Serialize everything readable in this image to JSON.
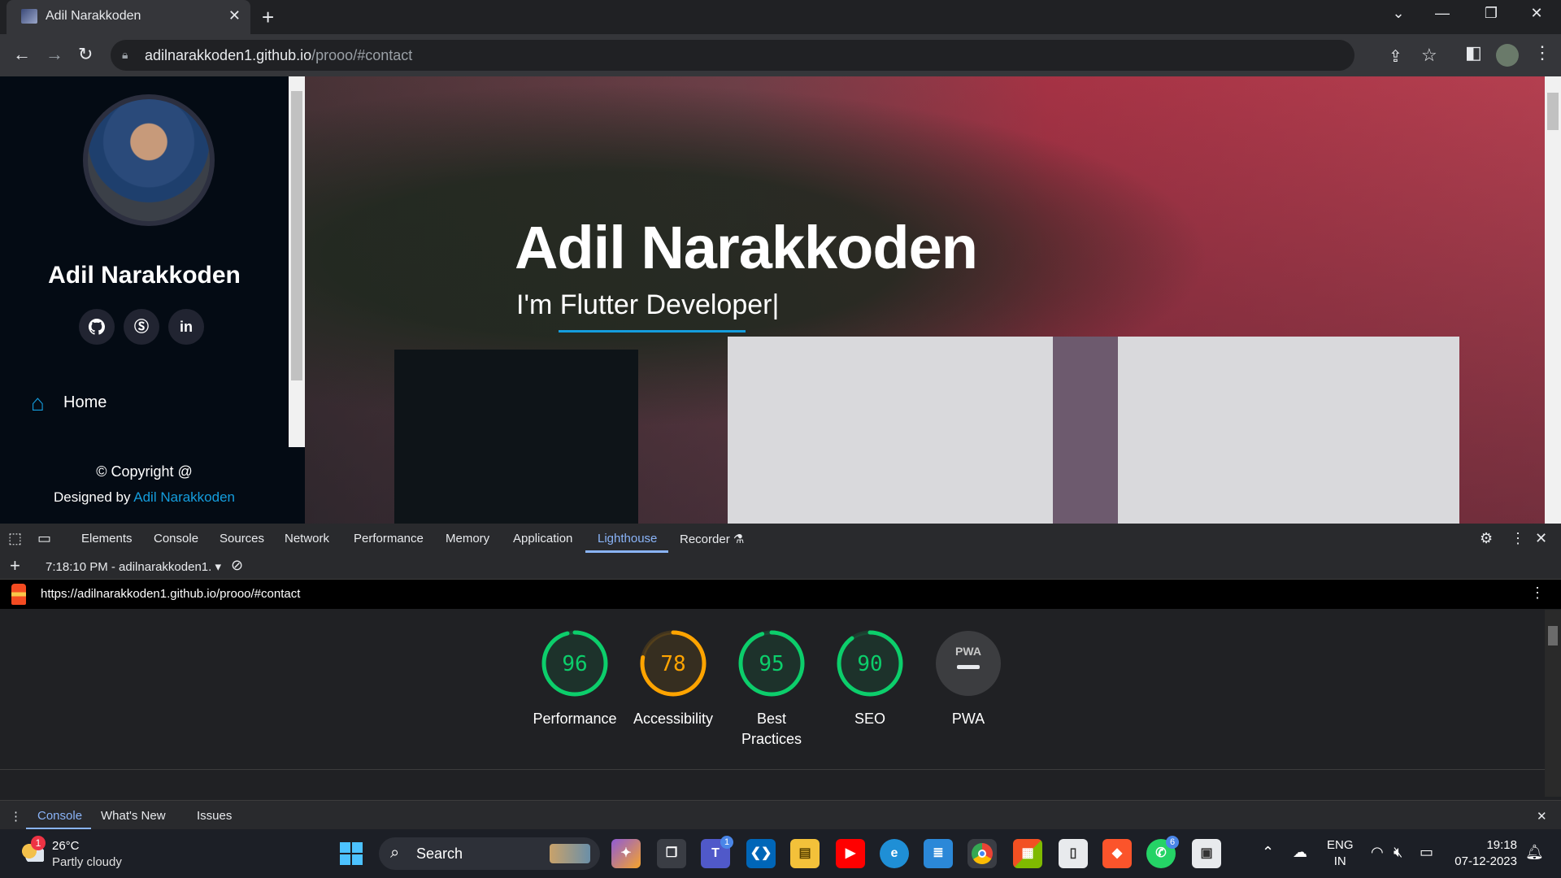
{
  "browser": {
    "tab_title": "Adil Narakkoden",
    "url_host": "adilnarakkoden1.github.io",
    "url_path": "/prooo/#contact"
  },
  "site": {
    "sidebar": {
      "name": "Adil Narakkoden",
      "social": [
        "github",
        "skype",
        "in"
      ],
      "nav_home": "Home",
      "copyright": "© Copyright @",
      "designed_prefix": "Designed by ",
      "designed_link": "Adil Narakkoden"
    },
    "hero": {
      "title": "Adil Narakkoden",
      "subtitle": "I'm Flutter Developer|"
    }
  },
  "devtools": {
    "tabs": [
      "Elements",
      "Console",
      "Sources",
      "Network",
      "Performance",
      "Memory",
      "Application",
      "Lighthouse",
      "Recorder"
    ],
    "active_tab": "Lighthouse",
    "report_select": "7:18:10 PM - adilnarakkoden1.",
    "report_url": "https://adilnarakkoden1.github.io/prooo/#contact",
    "scores": [
      {
        "label": "Performance",
        "value": 96,
        "color": "#0cce6b"
      },
      {
        "label": "Accessibility",
        "value": 78,
        "color": "#ffa400"
      },
      {
        "label": "Best Practices",
        "value": 95,
        "color": "#0cce6b"
      },
      {
        "label": "SEO",
        "value": 90,
        "color": "#0cce6b"
      }
    ],
    "pwa": {
      "label": "PWA",
      "badge": "PWA"
    },
    "drawer_tabs": [
      "Console",
      "What's New",
      "Issues"
    ]
  },
  "taskbar": {
    "weather_temp": "26°C",
    "weather_desc": "Partly cloudy",
    "weather_badge": "1",
    "search": "Search",
    "lang_line1": "ENG",
    "lang_line2": "IN",
    "time": "19:18",
    "date": "07-12-2023",
    "teams_badge": "1",
    "whatsapp_badge": "6"
  }
}
